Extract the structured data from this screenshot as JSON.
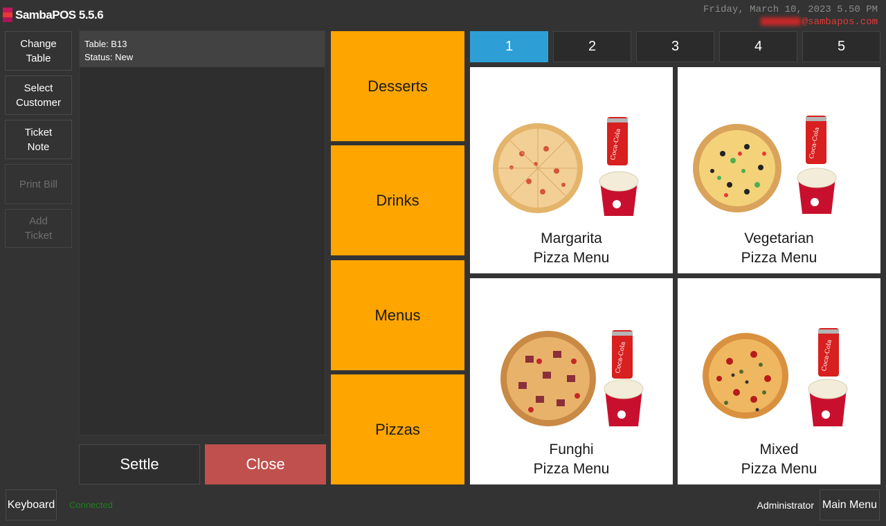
{
  "app": {
    "title": "SambaPOS 5.5.6",
    "logo_icon": "sambapos-logo-icon"
  },
  "header": {
    "datetime": "Friday, March 10, 2023 5.50 PM",
    "email_domain": "@sambapos.com"
  },
  "commands": [
    {
      "label": "Change\nTable",
      "enabled": true
    },
    {
      "label": "Select\nCustomer",
      "enabled": true
    },
    {
      "label": "Ticket\nNote",
      "enabled": true
    },
    {
      "label": "Print Bill",
      "enabled": false
    },
    {
      "label": "Add\nTicket",
      "enabled": false
    }
  ],
  "ticket": {
    "table": "Table: B13",
    "status": "Status: New"
  },
  "actions": {
    "settle": "Settle",
    "close": "Close"
  },
  "categories": [
    "Desserts",
    "Drinks",
    "Menus",
    "Pizzas"
  ],
  "pages": {
    "tabs": [
      "1",
      "2",
      "3",
      "4",
      "5"
    ],
    "active": "1"
  },
  "products": [
    {
      "name": "Margarita",
      "subtitle": "Pizza Menu"
    },
    {
      "name": "Vegetarian",
      "subtitle": "Pizza Menu"
    },
    {
      "name": "Funghi",
      "subtitle": "Pizza Menu"
    },
    {
      "name": "Mixed",
      "subtitle": "Pizza Menu"
    }
  ],
  "statusbar": {
    "keyboard": "Keyboard",
    "connection": "Connected",
    "user": "Administrator",
    "main_menu": "Main Menu"
  },
  "colors": {
    "accent": "#2e9fd6",
    "category": "#ffa500",
    "close": "#c0504d",
    "connected": "#1e7e1e",
    "email": "#e53935"
  }
}
